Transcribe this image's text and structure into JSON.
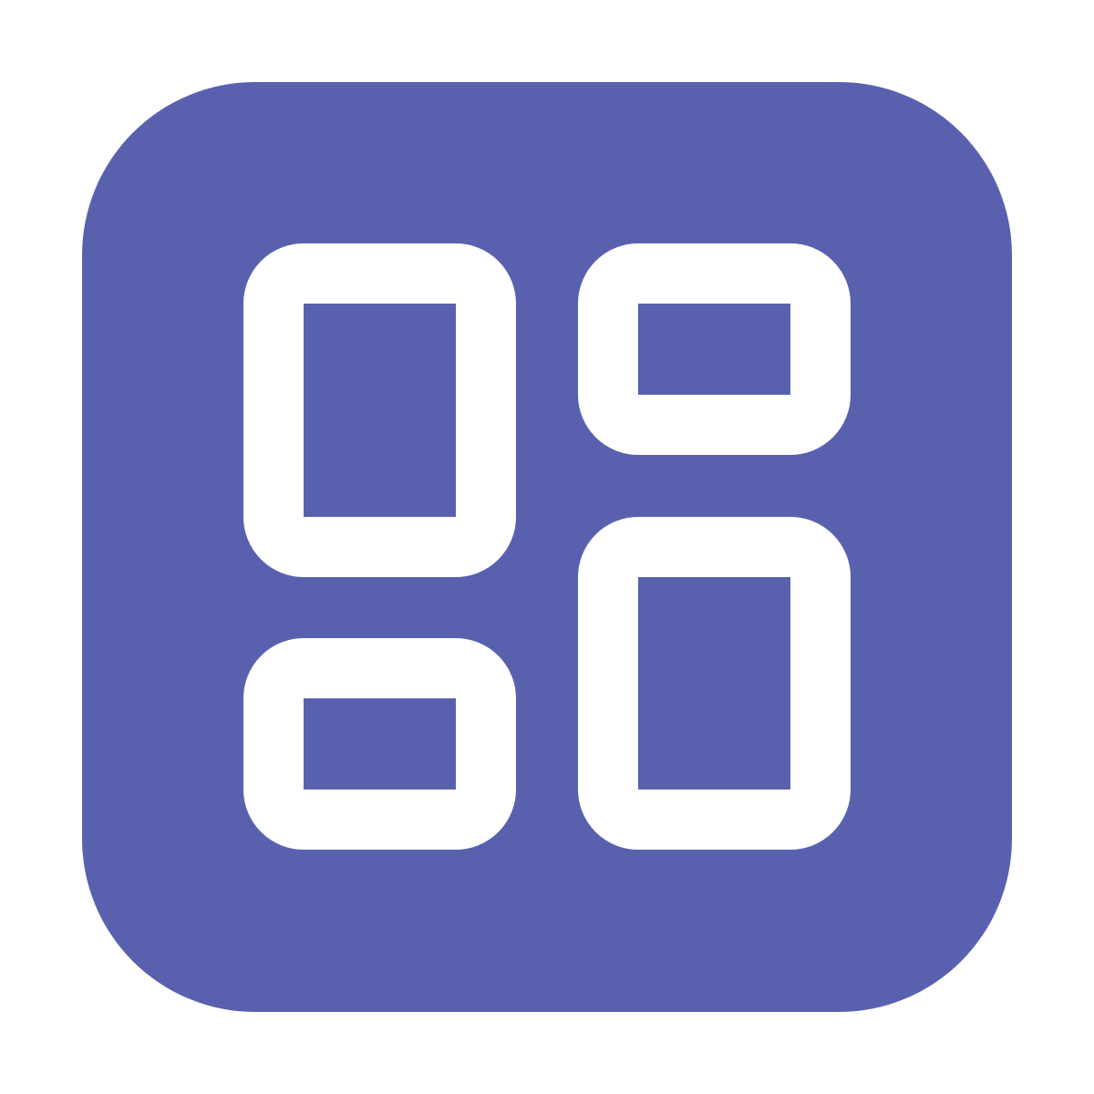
{
  "icon": {
    "name": "dashboard-layout-icon",
    "colors": {
      "background": "#ffffff",
      "tile": "#5961AF",
      "glyph": "#ffffff"
    },
    "panels": [
      "tall-top-left",
      "short-top-right",
      "short-bottom-left",
      "tall-bottom-right"
    ]
  }
}
